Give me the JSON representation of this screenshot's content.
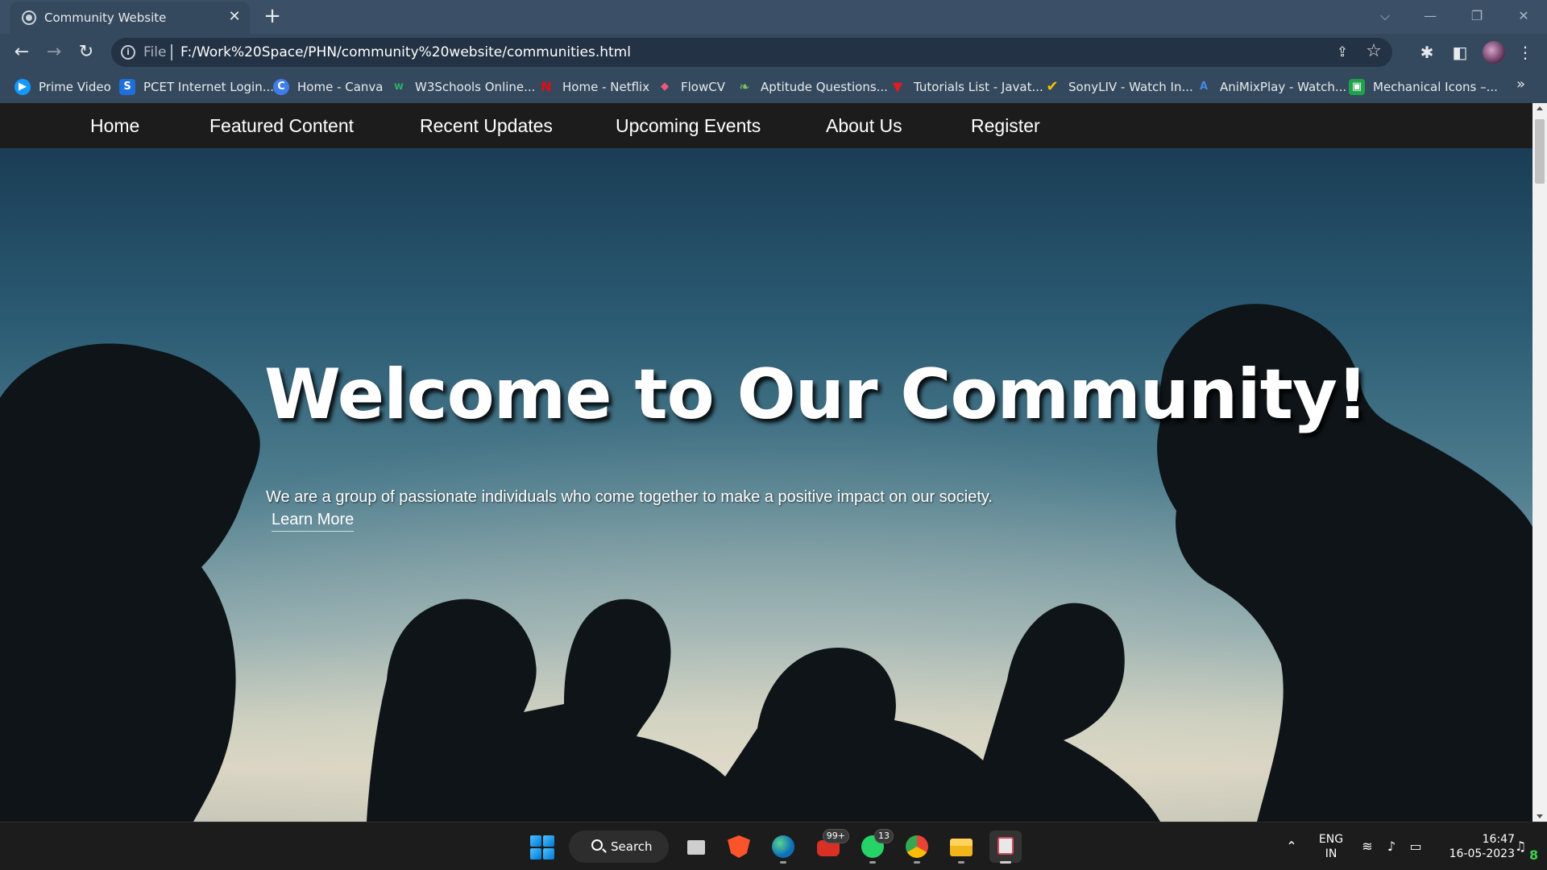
{
  "browser": {
    "tab_title": "Community Website",
    "new_tab": "+",
    "close_tab": "✕",
    "scheme": "File",
    "url": "F:/Work%20Space/PHN/community%20website/communities.html"
  },
  "bookmarks": [
    {
      "label": "Prime Video",
      "icon": "prime-video-icon",
      "glyph": "▶",
      "color": "#1399ff"
    },
    {
      "label": "PCET Internet Login...",
      "icon": "pcet-icon",
      "glyph": "S",
      "color": "#1e6fd9"
    },
    {
      "label": "Home - Canva",
      "icon": "canva-icon",
      "glyph": "C",
      "color": "#3f7de8"
    },
    {
      "label": "W3Schools Online...",
      "icon": "w3schools-icon",
      "glyph": "w",
      "color": "#2e8b57"
    },
    {
      "label": "Home - Netflix",
      "icon": "netflix-icon",
      "glyph": "N",
      "color": "#e50914"
    },
    {
      "label": "FlowCV",
      "icon": "flowcv-icon",
      "glyph": "◆",
      "color": "#f0587c"
    },
    {
      "label": "Aptitude Questions...",
      "icon": "aptitude-icon",
      "glyph": "❧",
      "color": "#6aa84f"
    },
    {
      "label": "Tutorials List - Javat...",
      "icon": "javatpoint-icon",
      "glyph": "▼",
      "color": "#e01b22"
    },
    {
      "label": "SonyLIV - Watch In...",
      "icon": "sonyliv-icon",
      "glyph": "✔",
      "color": "#f2c200"
    },
    {
      "label": "AniMixPlay - Watch...",
      "icon": "animixplay-icon",
      "glyph": "A",
      "color": "#3a6fd8"
    },
    {
      "label": "Mechanical Icons –...",
      "icon": "mechanical-icons-icon",
      "glyph": "▣",
      "color": "#1fa34a"
    }
  ],
  "bookmarks_more": "»",
  "site": {
    "nav": [
      "Home",
      "Featured Content",
      "Recent Updates",
      "Upcoming Events",
      "About Us",
      "Register"
    ],
    "hero_title": "Welcome to Our Community!",
    "hero_subtitle": "We are a group of passionate individuals who come together to make a positive impact on our society.",
    "hero_link": "Learn More"
  },
  "taskbar": {
    "search_label": "Search",
    "mail_badge": "99+",
    "whatsapp_badge": "13",
    "lang_top": "ENG",
    "lang_bottom": "IN",
    "time": "16:47",
    "date": "16-05-2023",
    "notification_count": "8"
  }
}
